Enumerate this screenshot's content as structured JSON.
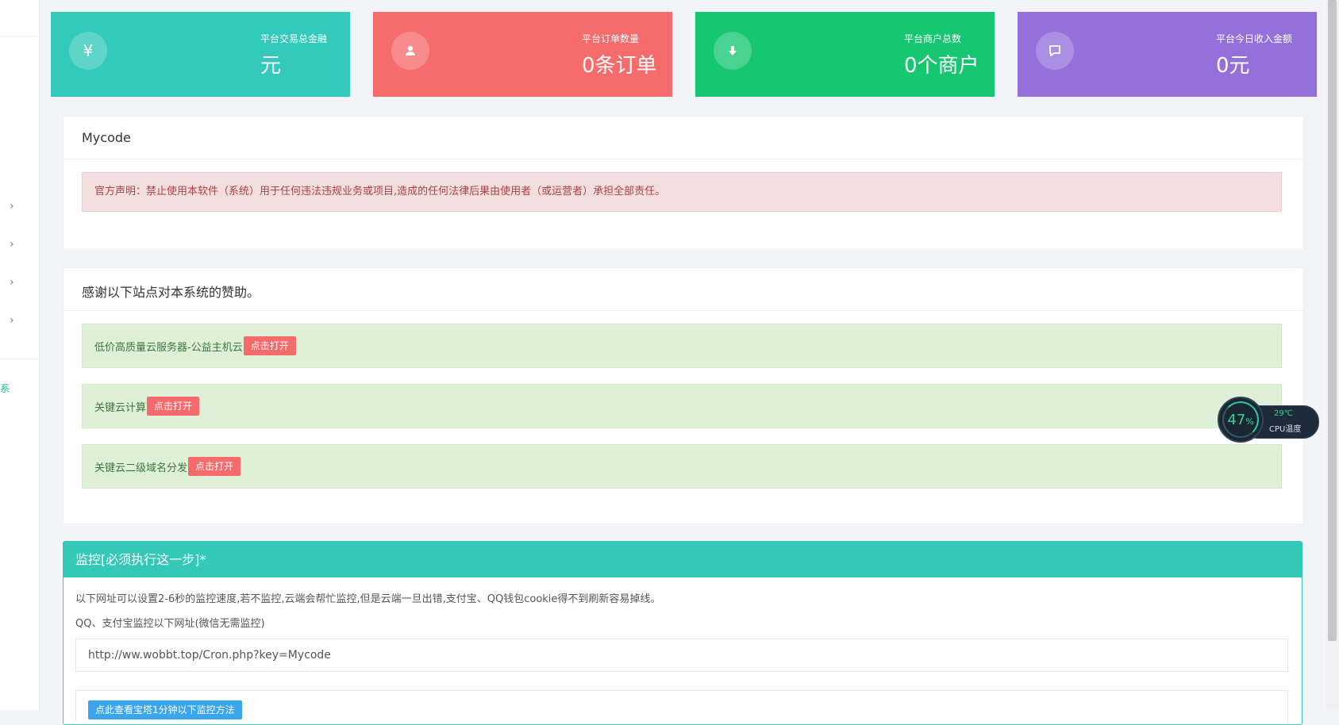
{
  "stats": [
    {
      "label": "平台交易总金融",
      "value": "元",
      "icon": "yen-icon",
      "color": "#33c9bb"
    },
    {
      "label": "平台订单数量",
      "value": "0条订单",
      "icon": "user-icon",
      "color": "#f66b6b"
    },
    {
      "label": "平台商户总数",
      "value": "0个商户",
      "icon": "download-icon",
      "color": "#17c671"
    },
    {
      "label": "平台今日收入金额",
      "value": "0元",
      "icon": "message-icon",
      "color": "#9470db"
    }
  ],
  "notice": {
    "title": "Mycode",
    "text": "官方声明：禁止使用本软件（系统）用于任何违法违规业务或项目,造成的任何法律后果由使用者（或运营者）承担全部责任。"
  },
  "sponsors": {
    "title": "感谢以下站点对本系统的赞助。",
    "button_label": "点击打开",
    "items": [
      {
        "name": "低价高质量云服务器-公益主机云"
      },
      {
        "name": "关键云计算"
      },
      {
        "name": "关键云二级域名分发"
      }
    ]
  },
  "monitor": {
    "title": "监控[必须执行这一步]*",
    "desc": "以下网址可以设置2-6秒的监控速度,若不监控,云端会帮忙监控,但是云端一旦出错,支付宝、QQ钱包cookie得不到刷新容易掉线。",
    "subtitle": "QQ、支付宝监控以下网址(微信无需监控)",
    "url": "http://ww.wobbt.top/Cron.php?key=Mycode",
    "guide_button": "点此查看宝塔1分钟以下监控方法"
  },
  "cpu_widget": {
    "percent": "47",
    "percent_unit": "%",
    "temperature": "29℃",
    "label": "CPU温度"
  },
  "sidebar": {
    "fragment_text": "系"
  }
}
